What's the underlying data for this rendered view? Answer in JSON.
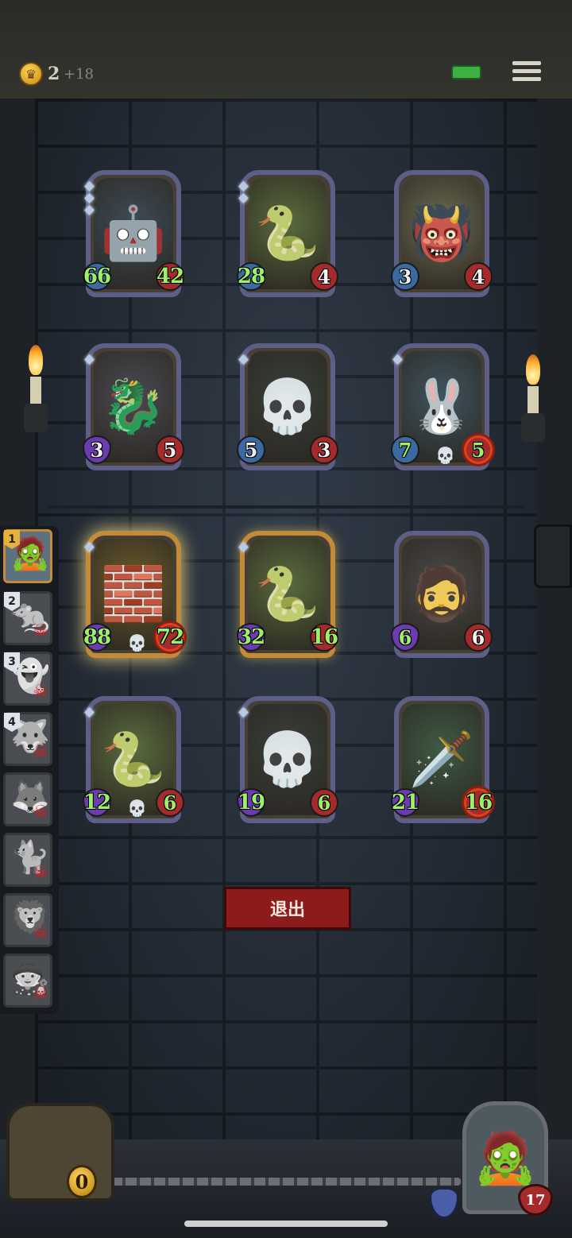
{
  "status_bar": {
    "gold_icon": "crown-coin-icon",
    "gold": "2",
    "gold_income": "+18",
    "battery_color": "#3cb043",
    "menu_icon": "hamburger-menu-icon"
  },
  "enemy_board": [
    {
      "name": "armored-knight",
      "icon": "🤖",
      "bg": "#3e4c56",
      "stars": 3,
      "attack": "66",
      "health": "42",
      "attack_buffed": true,
      "health_buffed": true
    },
    {
      "name": "serpent-dragon",
      "icon": "🐍",
      "bg": "#5a6b3e",
      "stars": 2,
      "attack": "28",
      "health": "4",
      "attack_buffed": true,
      "health_buffed": false
    },
    {
      "name": "tribal-beast",
      "icon": "👹",
      "bg": "#6d6a52",
      "stars": 0,
      "attack": "3",
      "health": "4",
      "attack_buffed": false,
      "health_buffed": false
    },
    {
      "name": "bone-dragon",
      "icon": "🐉",
      "bg": "#4a4a52",
      "stars": 1,
      "attack": "3",
      "health": "5",
      "attack_type": "purple"
    },
    {
      "name": "skull-mage",
      "icon": "💀",
      "bg": "#3a3f3a",
      "stars": 1,
      "attack": "5",
      "health": "3"
    },
    {
      "name": "stitched-bunny",
      "icon": "🐰",
      "bg": "#3f5560",
      "stars": 1,
      "attack": "7",
      "health": "5",
      "attack_buffed": true,
      "health_buffed": true,
      "skull": true,
      "health_target": true
    }
  ],
  "player_board": [
    {
      "name": "golden-golem",
      "icon": "🧱",
      "bg": "#6b5b2a",
      "gold": true,
      "glow": true,
      "stars": 1,
      "attack": "88",
      "health": "72",
      "attack_type": "purple",
      "skull": true,
      "health_target": true,
      "attack_buffed": true,
      "health_buffed": true
    },
    {
      "name": "serpent-dragon",
      "icon": "🐍",
      "bg": "#5a6b3e",
      "gold": true,
      "stars": 1,
      "attack": "32",
      "health": "16",
      "attack_type": "purple",
      "attack_buffed": true,
      "health_buffed": true
    },
    {
      "name": "bearded-warrior",
      "icon": "🧔",
      "bg": "#4b4a48",
      "stars": 0,
      "attack": "6",
      "health": "6",
      "attack_type": "purple",
      "attack_buffed": true,
      "health_buffed": false
    },
    {
      "name": "serpent-dragon-2",
      "icon": "🐍",
      "bg": "#5a6b3e",
      "stars": 1,
      "attack": "12",
      "health": "6",
      "attack_type": "purple",
      "skull": true,
      "attack_buffed": true,
      "health_buffed": true
    },
    {
      "name": "skull-mage-2",
      "icon": "💀",
      "bg": "#3a3f3a",
      "stars": 1,
      "attack": "19",
      "health": "6",
      "attack_type": "purple",
      "attack_buffed": true,
      "health_buffed": true
    },
    {
      "name": "poison-blade",
      "icon": "🗡️",
      "bg": "#3e5a44",
      "stars": 0,
      "attack": "21",
      "health": "16",
      "attack_type": "purple",
      "attack_buffed": true,
      "health_buffed": true,
      "health_target": true
    }
  ],
  "exit_button": {
    "label": "退出"
  },
  "opponent_list": [
    {
      "rank": "1",
      "icon": "🧟",
      "active": true,
      "dead": false
    },
    {
      "rank": "2",
      "icon": "🐀",
      "active": false,
      "dead": true
    },
    {
      "rank": "3",
      "icon": "👻",
      "active": false,
      "dead": true
    },
    {
      "rank": "4",
      "icon": "🐺",
      "active": false,
      "dead": true
    },
    {
      "rank": "",
      "icon": "🦊",
      "active": false,
      "dead": true
    },
    {
      "rank": "",
      "icon": "🐈",
      "active": false,
      "dead": true
    },
    {
      "rank": "",
      "icon": "🦁",
      "active": false,
      "dead": true
    },
    {
      "rank": "",
      "icon": "🧙",
      "active": false,
      "dead": true
    }
  ],
  "bottom_bar": {
    "chest_count": "0",
    "shield_icon": "shield-icon",
    "hero_icon": "🧟",
    "hero_health": "17"
  }
}
